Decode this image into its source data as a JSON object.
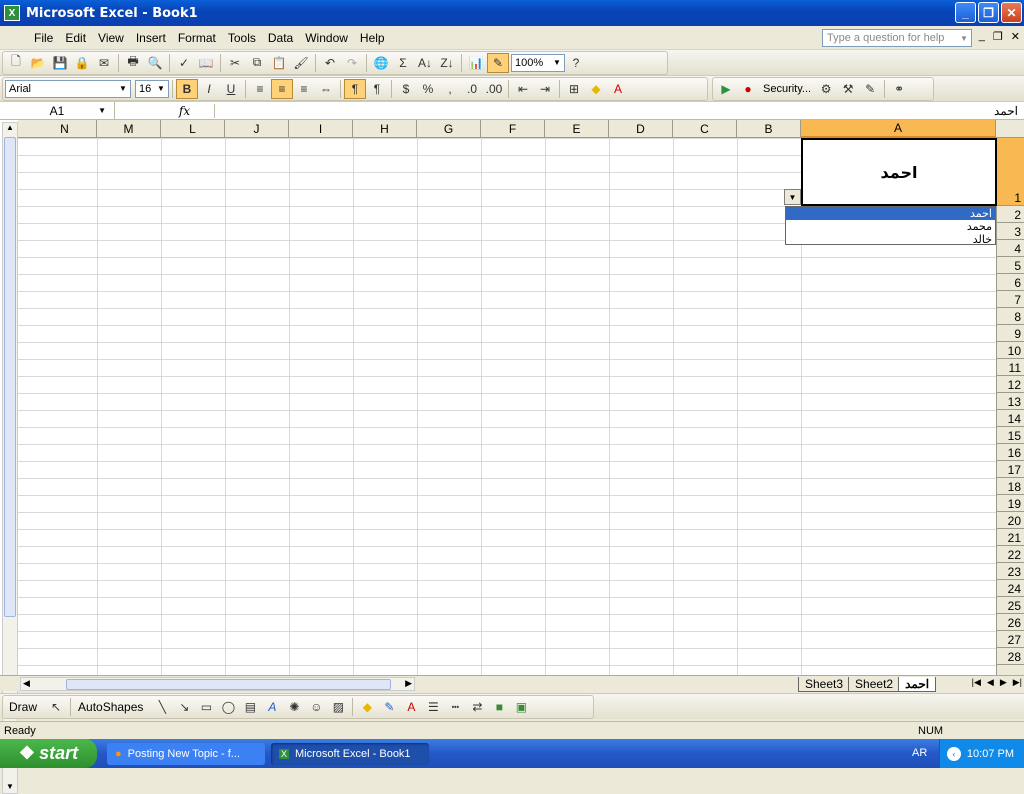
{
  "window": {
    "title": "Microsoft Excel - Book1",
    "app_icon": "X"
  },
  "window_controls": {
    "minimize": "_",
    "maximize": "❐",
    "close": "✕"
  },
  "menu": [
    "File",
    "Edit",
    "View",
    "Insert",
    "Format",
    "Tools",
    "Data",
    "Window",
    "Help"
  ],
  "help_box": {
    "placeholder": "Type a question for help"
  },
  "toolbar": {
    "zoom": "100%"
  },
  "format": {
    "font": "Arial",
    "size": "16",
    "security": "Security..."
  },
  "formula_bar": {
    "name_box": "A1",
    "fx": "fx",
    "content": "احمد"
  },
  "columns": [
    "N",
    "M",
    "L",
    "J",
    "I",
    "H",
    "G",
    "F",
    "E",
    "D",
    "C",
    "B",
    "A"
  ],
  "rows": [
    "1",
    "2",
    "3",
    "4",
    "5",
    "6",
    "7",
    "8",
    "9",
    "10",
    "11",
    "12",
    "13",
    "14",
    "15",
    "16",
    "17",
    "18",
    "19",
    "20",
    "21",
    "22",
    "23",
    "24",
    "25",
    "26",
    "27",
    "28"
  ],
  "cell_a1": "احمد",
  "dropdown": {
    "items": [
      "احمد",
      "محمد",
      "خالد"
    ],
    "selected_index": 0
  },
  "sheets": [
    "Sheet3",
    "Sheet2",
    "احمد"
  ],
  "active_sheet": "احمد",
  "drawbar": {
    "draw": "Draw",
    "autoshapes": "AutoShapes"
  },
  "status": {
    "ready": "Ready",
    "num": "NUM"
  },
  "taskbar": {
    "start": "start",
    "items": [
      "Posting New Topic - f...",
      "Microsoft Excel - Book1"
    ],
    "lang": "AR",
    "clock": "10:07 PM"
  },
  "colors": {
    "selected_header": "#f8b852",
    "titlebar": "#0846b8",
    "list_highlight": "#316ac5"
  }
}
